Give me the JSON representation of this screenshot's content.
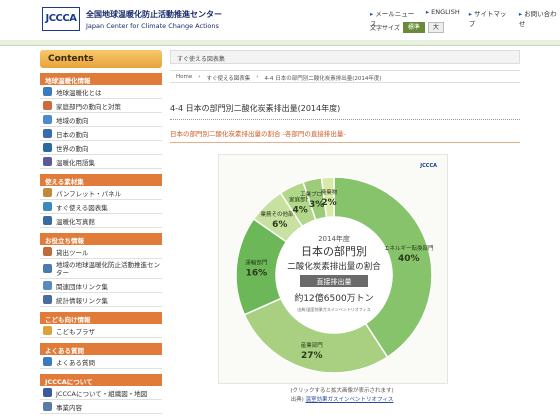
{
  "header": {
    "logo_text": "JCCCA",
    "org_name_jp": "全国地球温暖化防止活動推進センター",
    "org_name_en": "Japan Center for Climate Change Actions",
    "links": [
      "メールニュース",
      "ENGLISH",
      "サイトマップ",
      "お問い合わせ"
    ],
    "font_size_label": "文字サイズ",
    "font_size_options": [
      "標準",
      "大"
    ]
  },
  "sidebar": {
    "title": "Contents",
    "sections": [
      {
        "title": "地球温暖化情報",
        "items": [
          "地球温暖化とは",
          "家庭部門の動向と対策",
          "地域の動向",
          "日本の動向",
          "世界の動向",
          "温暖化用語集"
        ]
      },
      {
        "title": "使える素材集",
        "items": [
          "パンフレット・パネル",
          "すぐ使える図表集",
          "温暖化写真館"
        ]
      },
      {
        "title": "お役立ち情報",
        "items": [
          "貸出ツール",
          "地域の地球温暖化防止活動推進センター",
          "関連団体リンク集",
          "統計情報リンク集"
        ]
      },
      {
        "title": "こども向け情報",
        "items": [
          "こどもプラザ"
        ]
      },
      {
        "title": "よくある質問",
        "items": [
          "よくある質問"
        ]
      },
      {
        "title": "JCCCAについて",
        "items": [
          "JCCCAについて・組織図・地図",
          "事業内容"
        ]
      }
    ]
  },
  "main": {
    "breadcrumb_bar": "すぐ使える図表集",
    "breadcrumbs": [
      "Home",
      "すぐ使える図表集",
      "4-4 日本の部門別二酸化炭素排出量(2014年度)"
    ],
    "page_title": "4-4 日本の部門別二酸化炭素排出量(2014年度)",
    "sub_heading": "日本の部門別二酸化炭素排出量の割合 -各部門の直接排出量-",
    "caption_line1": "(クリックすると拡大画像が表示されます)",
    "caption_source_prefix": "出典) ",
    "caption_source_link": "温室効果ガスインベントリオフィス"
  },
  "chart_data": {
    "type": "pie",
    "title_year": "2014年度",
    "title_line1": "日本の部門別",
    "title_line2": "二酸化炭素排出量の割合",
    "subtitle_box": "直接排出量",
    "total_label": "約12億6500万トン",
    "source_note": "出典)温室効果ガスインベントリオフィス",
    "publisher_mark": "JCCCA",
    "categories": [
      "エネルギー転換部門",
      "産業部門",
      "運輸部門",
      "業務その他部門",
      "家庭部門",
      "工業プロセス",
      "廃棄物"
    ],
    "values": [
      40,
      27,
      16,
      6,
      4,
      3,
      2
    ],
    "value_unit": "%",
    "colors": [
      "#86c36a",
      "#a8d080",
      "#6cb858",
      "#c8e0a0",
      "#b0d888",
      "#9ccc7a",
      "#d8eaa8"
    ]
  }
}
